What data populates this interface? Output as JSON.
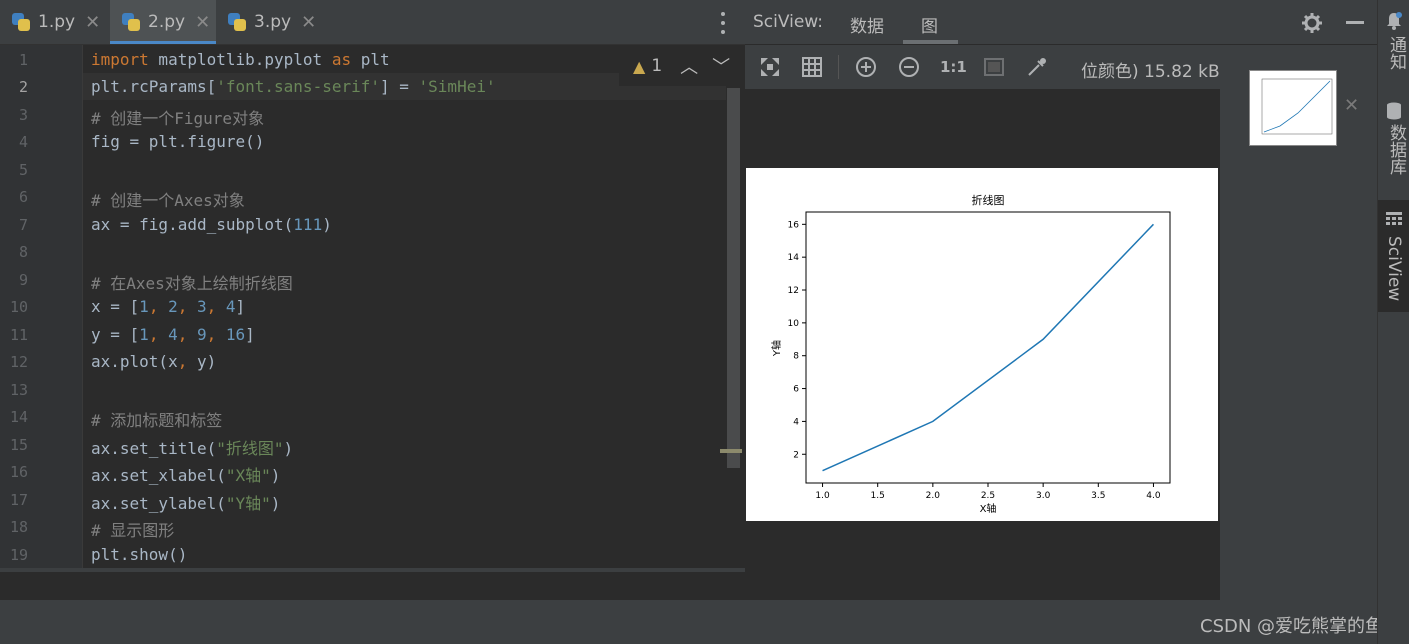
{
  "editor": {
    "tabs": [
      {
        "label": "1.py"
      },
      {
        "label": "2.py"
      },
      {
        "label": "3.py"
      }
    ],
    "warning_count": "1",
    "line_numbers": [
      "1",
      "2",
      "3",
      "4",
      "5",
      "6",
      "7",
      "8",
      "9",
      "10",
      "11",
      "12",
      "13",
      "14",
      "15",
      "16",
      "17",
      "18",
      "19"
    ]
  },
  "sciview": {
    "title": "SciView:",
    "tabs": [
      {
        "label": "数据"
      },
      {
        "label": "图"
      }
    ],
    "zoom_1to1": "1:1",
    "image_info": "位颜色) 15.82 kB"
  },
  "right_sidebar": {
    "notifications": "通知",
    "database": "数据库",
    "sciview": "SciView"
  },
  "watermark": "CSDN @爱吃熊掌的鱼",
  "chart_data": {
    "type": "line",
    "title": "折线图",
    "xlabel": "X轴",
    "ylabel": "Y轴",
    "x": [
      1,
      2,
      3,
      4
    ],
    "series": [
      {
        "values": [
          1,
          4,
          9,
          16
        ]
      }
    ],
    "xlim": [
      0.85,
      4.15
    ],
    "ylim": [
      0.25,
      16.75
    ],
    "xticks": [
      "1.0",
      "1.5",
      "2.0",
      "2.5",
      "3.0",
      "3.5",
      "4.0"
    ],
    "yticks": [
      "2",
      "4",
      "6",
      "8",
      "10",
      "12",
      "14",
      "16"
    ],
    "line_color": "#1f77b4",
    "grid": false
  }
}
